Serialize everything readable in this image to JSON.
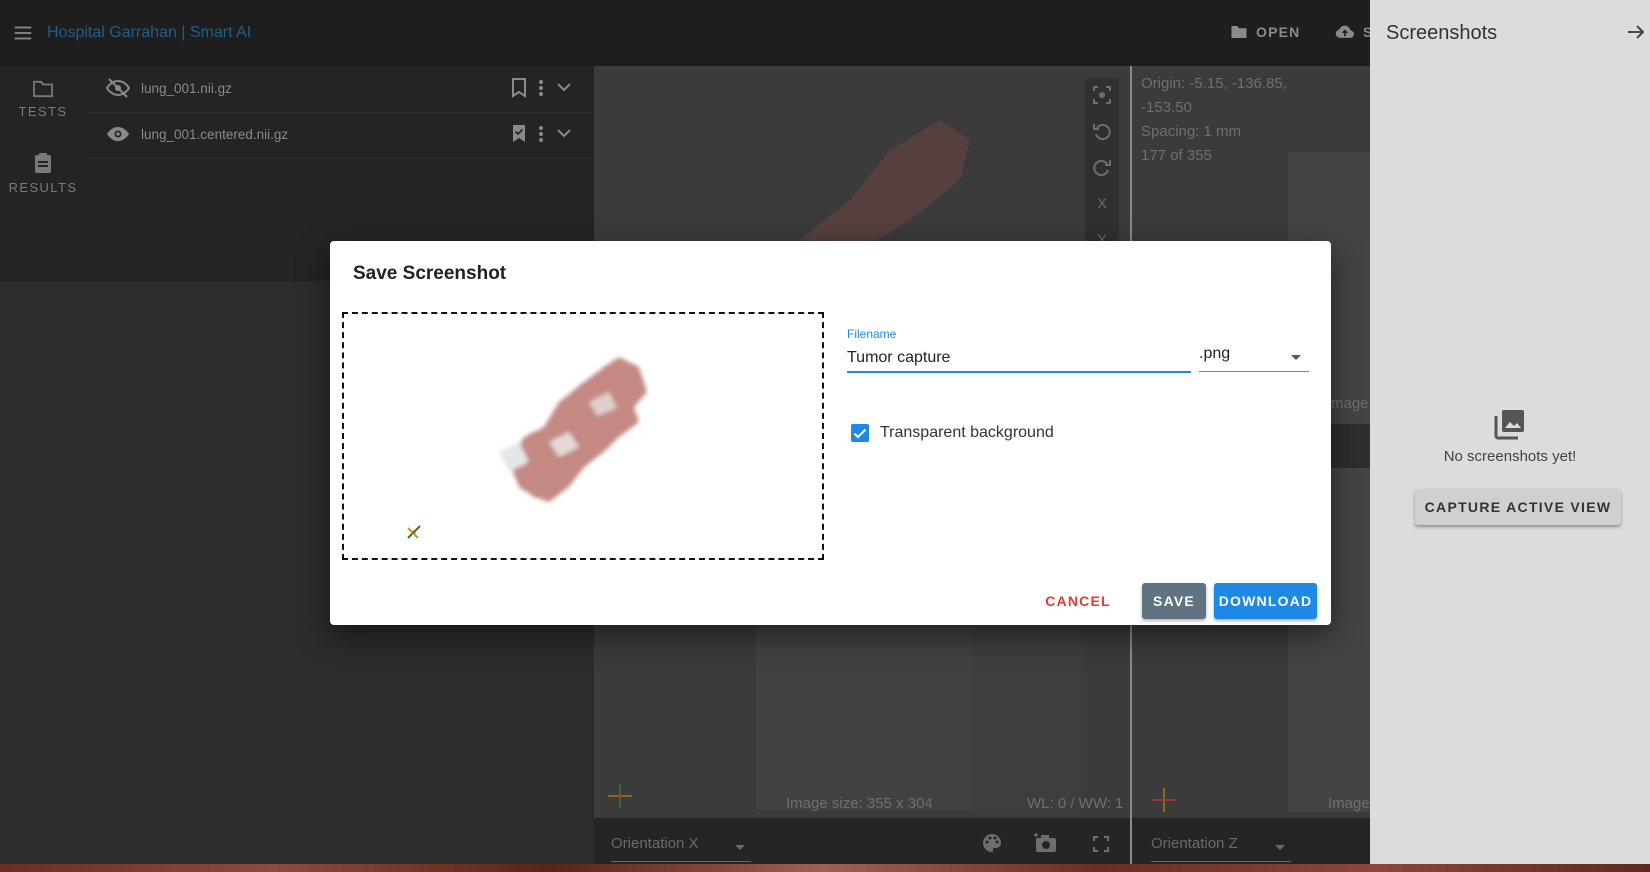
{
  "app": {
    "title": "Hospital Garrahan | Smart AI",
    "open_label": "OPEN",
    "save_label": "SA"
  },
  "rail": {
    "tests_label": "TESTS",
    "results_label": "RESULTS"
  },
  "files": [
    {
      "name": "lung_001.nii.gz",
      "visible": false,
      "bookmarked": false
    },
    {
      "name": "lung_001.centered.nii.gz",
      "visible": true,
      "bookmarked": true
    }
  ],
  "viewer_x": {
    "image_size": "Image size: 355 x 304",
    "wl_ww": "WL: 0 / WW: 1",
    "orientation": "Orientation X",
    "tool_x": "X",
    "tool_y": "Y"
  },
  "viewer_z": {
    "origin_line1": "Origin: -5.15, -136.85,",
    "origin_line2": "-153.50",
    "spacing": "Spacing: 1 mm",
    "slice": "177 of 355",
    "image_partial": "Image",
    "image_partial_top": "mage",
    "orientation": "Orientation Z"
  },
  "drawer": {
    "title": "Screenshots",
    "empty_text": "No screenshots yet!",
    "capture_label": "CAPTURE ACTIVE VIEW"
  },
  "dialog": {
    "title": "Save Screenshot",
    "filename_label": "Filename",
    "filename_value": "Tumor capture",
    "extension": ".png",
    "transparent_label": "Transparent background",
    "transparent_checked": true,
    "cancel_label": "CANCEL",
    "save_label": "SAVE",
    "download_label": "DOWNLOAD"
  },
  "colors": {
    "accent": "#1e88e5",
    "cancel": "#e53935",
    "save_button": "#5f7380",
    "title_link": "#1f5f8c"
  }
}
